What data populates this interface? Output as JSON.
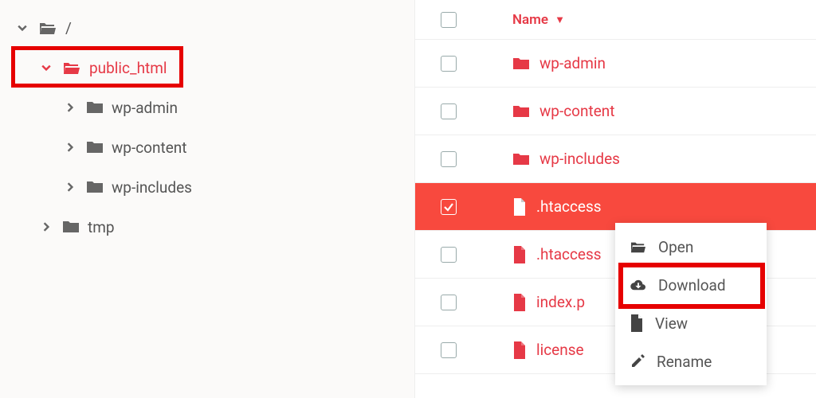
{
  "sidebar": {
    "root_label": "/",
    "items": [
      {
        "label": "public_html",
        "expanded": true,
        "selected": true,
        "level": 1
      },
      {
        "label": "wp-admin",
        "expanded": false,
        "selected": false,
        "level": 2
      },
      {
        "label": "wp-content",
        "expanded": false,
        "selected": false,
        "level": 2
      },
      {
        "label": "wp-includes",
        "expanded": false,
        "selected": false,
        "level": 2
      },
      {
        "label": "tmp",
        "expanded": false,
        "selected": false,
        "level": 1
      }
    ]
  },
  "list": {
    "name_header": "Name",
    "sort_indicator": "▼",
    "rows": [
      {
        "name": "wp-admin",
        "type": "folder",
        "checked": false
      },
      {
        "name": "wp-content",
        "type": "folder",
        "checked": false
      },
      {
        "name": "wp-includes",
        "type": "folder",
        "checked": false
      },
      {
        "name": ".htaccess",
        "type": "file",
        "checked": true
      },
      {
        "name": ".htaccess",
        "type": "file",
        "checked": false
      },
      {
        "name": "index.p",
        "type": "file",
        "checked": false
      },
      {
        "name": "license",
        "type": "file",
        "checked": false
      }
    ]
  },
  "context_menu": {
    "items": [
      {
        "label": "Open",
        "icon": "folder-open-icon"
      },
      {
        "label": "Download",
        "icon": "cloud-download-icon"
      },
      {
        "label": "View",
        "icon": "file-icon"
      },
      {
        "label": "Rename",
        "icon": "edit-icon"
      }
    ]
  },
  "colors": {
    "accent": "#e63946",
    "row_selected": "#f8493e",
    "highlight": "#e60000"
  }
}
